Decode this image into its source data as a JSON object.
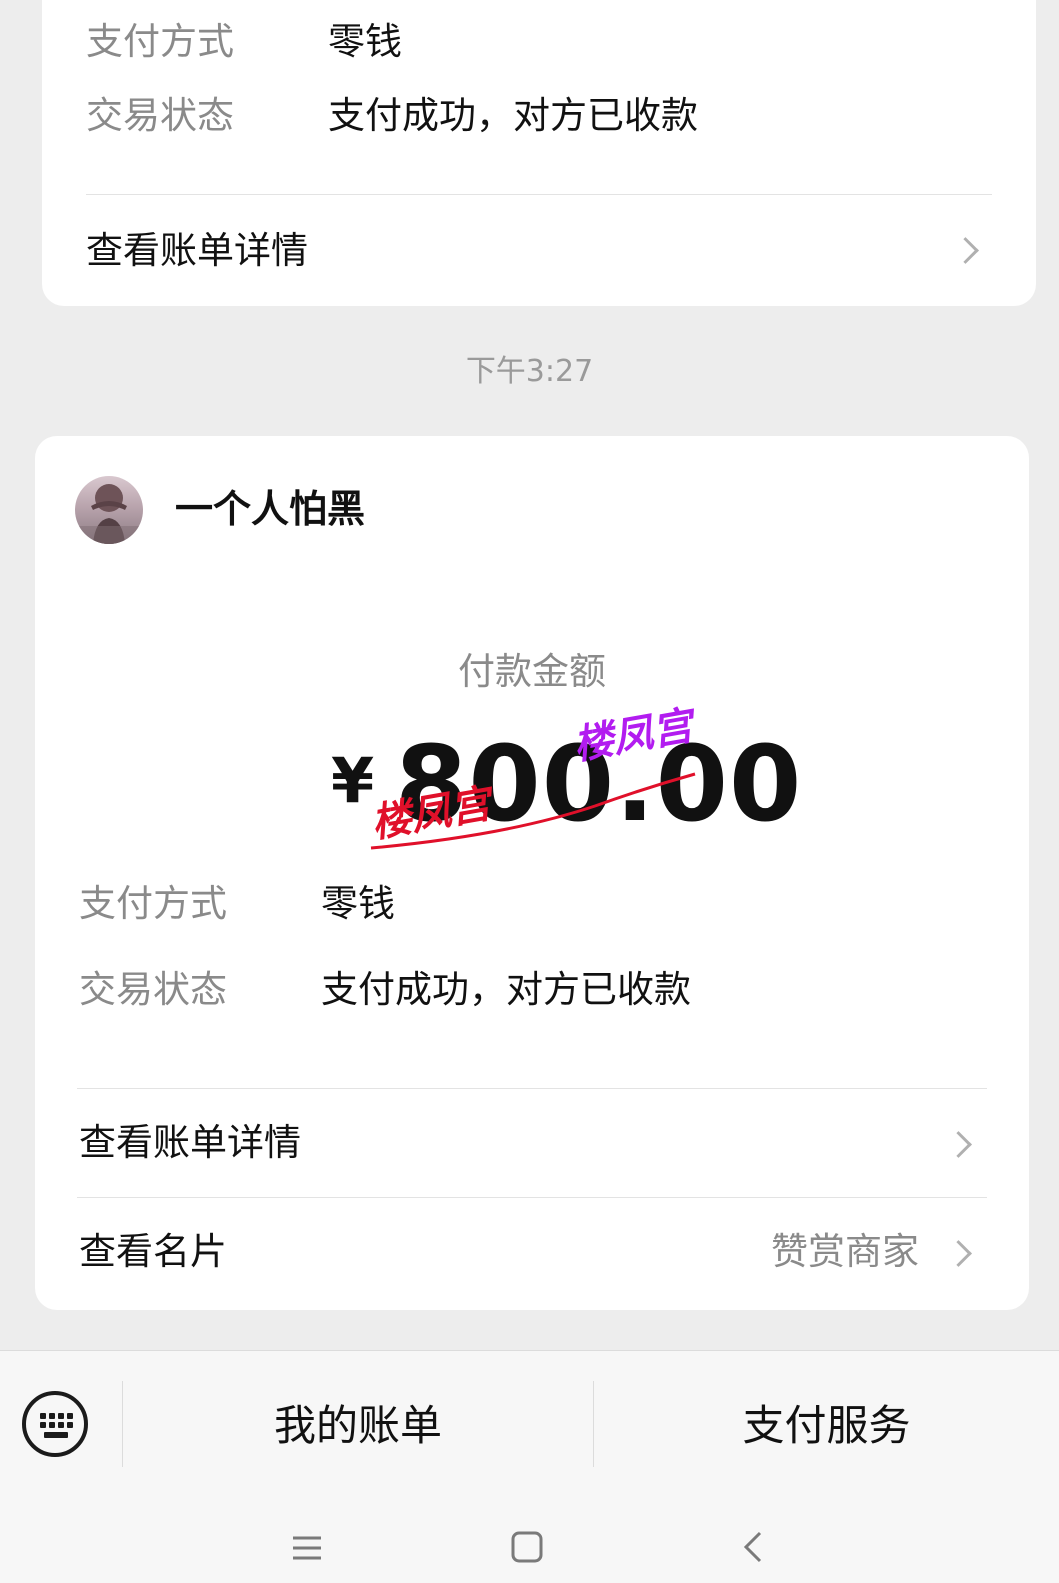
{
  "previous_payment": {
    "payment_method_label": "支付方式",
    "payment_method_value": "零钱",
    "status_label": "交易状态",
    "status_value": "支付成功，对方已收款",
    "bill_details_label": "查看账单详情"
  },
  "timestamp": "下午3:27",
  "payment": {
    "payer_name": "一个人怕黑",
    "amount_label": "付款金额",
    "currency_symbol": "¥",
    "amount": "800.00",
    "payment_method_label": "支付方式",
    "payment_method_value": "零钱",
    "status_label": "交易状态",
    "status_value": "支付成功，对方已收款",
    "bill_details_label": "查看账单详情",
    "business_card_label": "查看名片",
    "reward_merchant_label": "赞赏商家"
  },
  "watermarks": {
    "red_stamp": "楼凤宫",
    "purple_stamp": "楼凤宫",
    "red_color": "#e0102a",
    "purple_color": "#b21cf0"
  },
  "bottom_menu": {
    "keyboard_icon": "keyboard-icon",
    "my_bills": "我的账单",
    "payment_services": "支付服务"
  },
  "system_nav": {
    "menu_icon": "menu-lines-icon",
    "home_icon": "square-home-icon",
    "back_icon": "back-chevron-icon"
  }
}
